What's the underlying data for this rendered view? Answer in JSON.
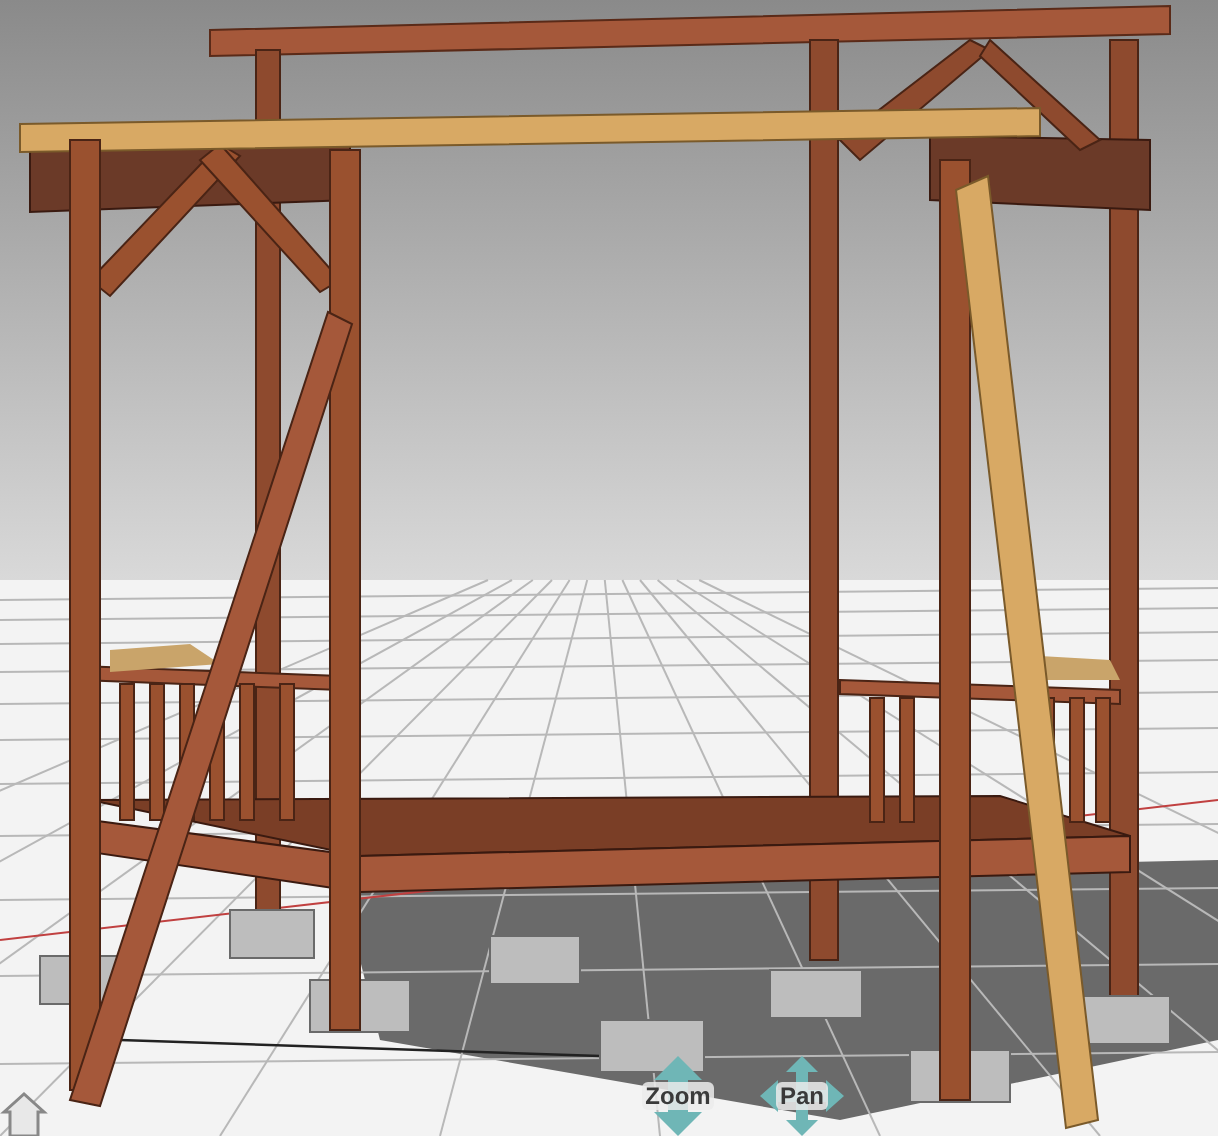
{
  "viewport": {
    "nav_controls": [
      {
        "kind": "zoom",
        "label": "Zoom"
      },
      {
        "kind": "pan",
        "label": "Pan"
      }
    ]
  }
}
